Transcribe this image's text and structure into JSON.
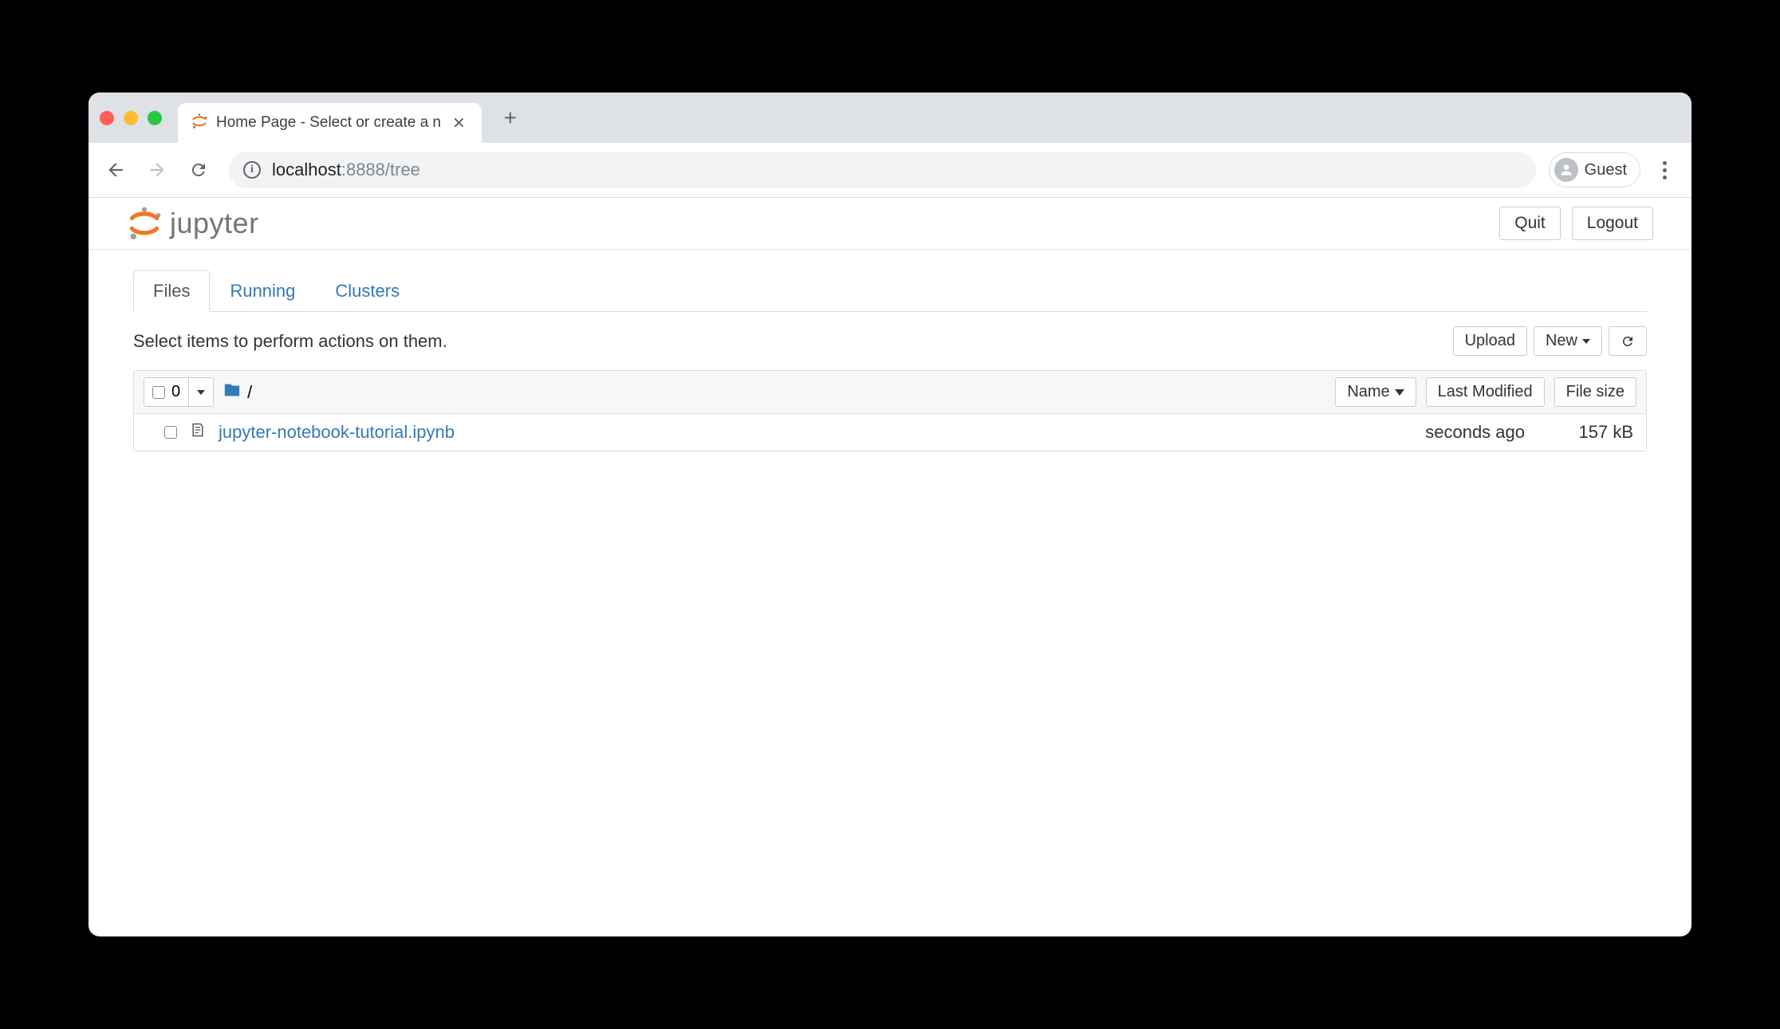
{
  "browser": {
    "tab_title": "Home Page - Select or create a n",
    "url_host": "localhost",
    "url_port_path": ":8888/tree",
    "profile_label": "Guest"
  },
  "header": {
    "logo_text": "jupyter",
    "quit_label": "Quit",
    "logout_label": "Logout"
  },
  "tabs": [
    {
      "label": "Files",
      "active": true
    },
    {
      "label": "Running",
      "active": false
    },
    {
      "label": "Clusters",
      "active": false
    }
  ],
  "instruction_text": "Select items to perform actions on them.",
  "toolbar": {
    "upload_label": "Upload",
    "new_label": "New"
  },
  "listing": {
    "selected_count": "0",
    "breadcrumb_separator": "/",
    "columns": {
      "name": "Name",
      "modified": "Last Modified",
      "size": "File size"
    },
    "items": [
      {
        "name": "jupyter-notebook-tutorial.ipynb",
        "modified": "seconds ago",
        "size": "157 kB"
      }
    ]
  },
  "colors": {
    "link": "#337ab7",
    "jupyter_orange": "#f37626"
  }
}
